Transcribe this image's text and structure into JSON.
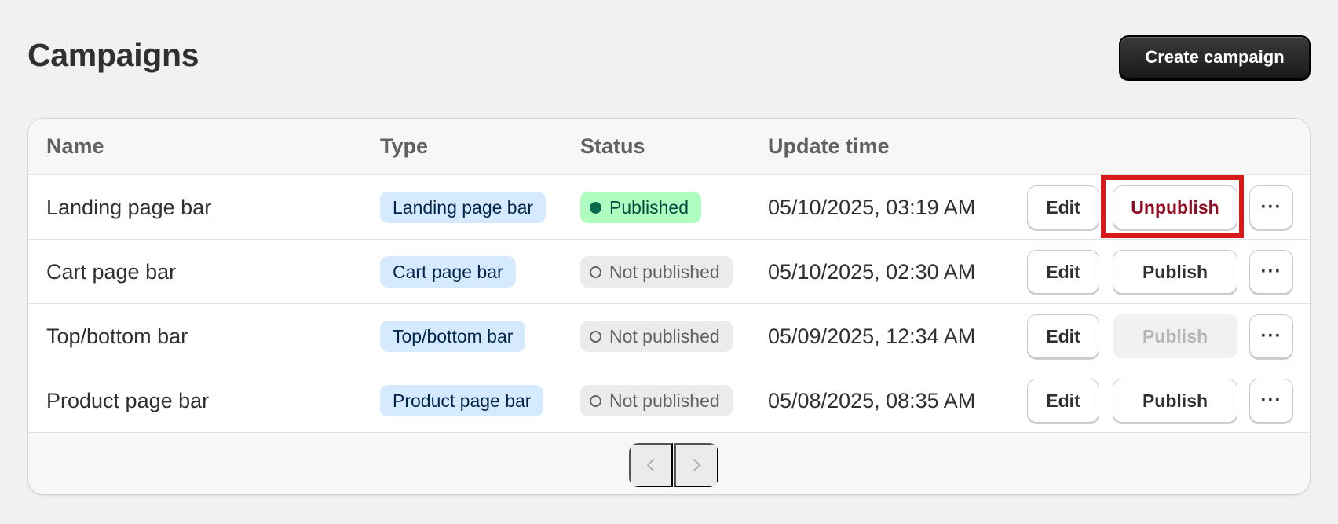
{
  "page": {
    "title": "Campaigns",
    "create_button": "Create campaign"
  },
  "table": {
    "columns": [
      "Name",
      "Type",
      "Status",
      "Update time"
    ],
    "rows": [
      {
        "name": "Landing page bar",
        "type": "Landing page bar",
        "status": "Published",
        "updated": "05/10/2025, 03:19 AM",
        "edit": "Edit",
        "action": "Unpublish",
        "more": "···"
      },
      {
        "name": "Cart page bar",
        "type": "Cart page bar",
        "status": "Not published",
        "updated": "05/10/2025, 02:30 AM",
        "edit": "Edit",
        "action": "Publish",
        "more": "···"
      },
      {
        "name": "Top/bottom bar",
        "type": "Top/bottom bar",
        "status": "Not published",
        "updated": "05/09/2025, 12:34 AM",
        "edit": "Edit",
        "action": "Publish",
        "action_disabled": true,
        "more": "···"
      },
      {
        "name": "Product page bar",
        "type": "Product page bar",
        "status": "Not published",
        "updated": "05/08/2025, 08:35 AM",
        "edit": "Edit",
        "action": "Publish",
        "more": "···"
      }
    ]
  },
  "pagination": {
    "prev_icon": "chevron-left-icon",
    "next_icon": "chevron-right-icon"
  },
  "colors": {
    "highlight": "#d71919",
    "published_badge": "#affebf",
    "type_badge": "#d6eaff",
    "unpublish_text": "#8e0b21"
  }
}
